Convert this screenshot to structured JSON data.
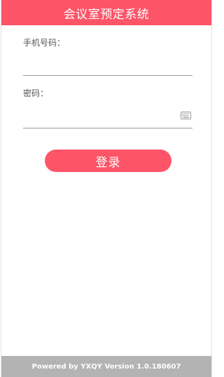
{
  "header": {
    "title": "会议室预定系统"
  },
  "form": {
    "phone_label": "手机号码：",
    "phone_value": "",
    "password_label": "密码：",
    "password_value": "",
    "keyboard_icon": "keyboard-icon"
  },
  "actions": {
    "login_label": "登录"
  },
  "footer": {
    "text": "Powered by YXQY Version 1.0.180607"
  },
  "colors": {
    "accent": "#fd5468",
    "footer_bg": "#b3b3b3"
  }
}
